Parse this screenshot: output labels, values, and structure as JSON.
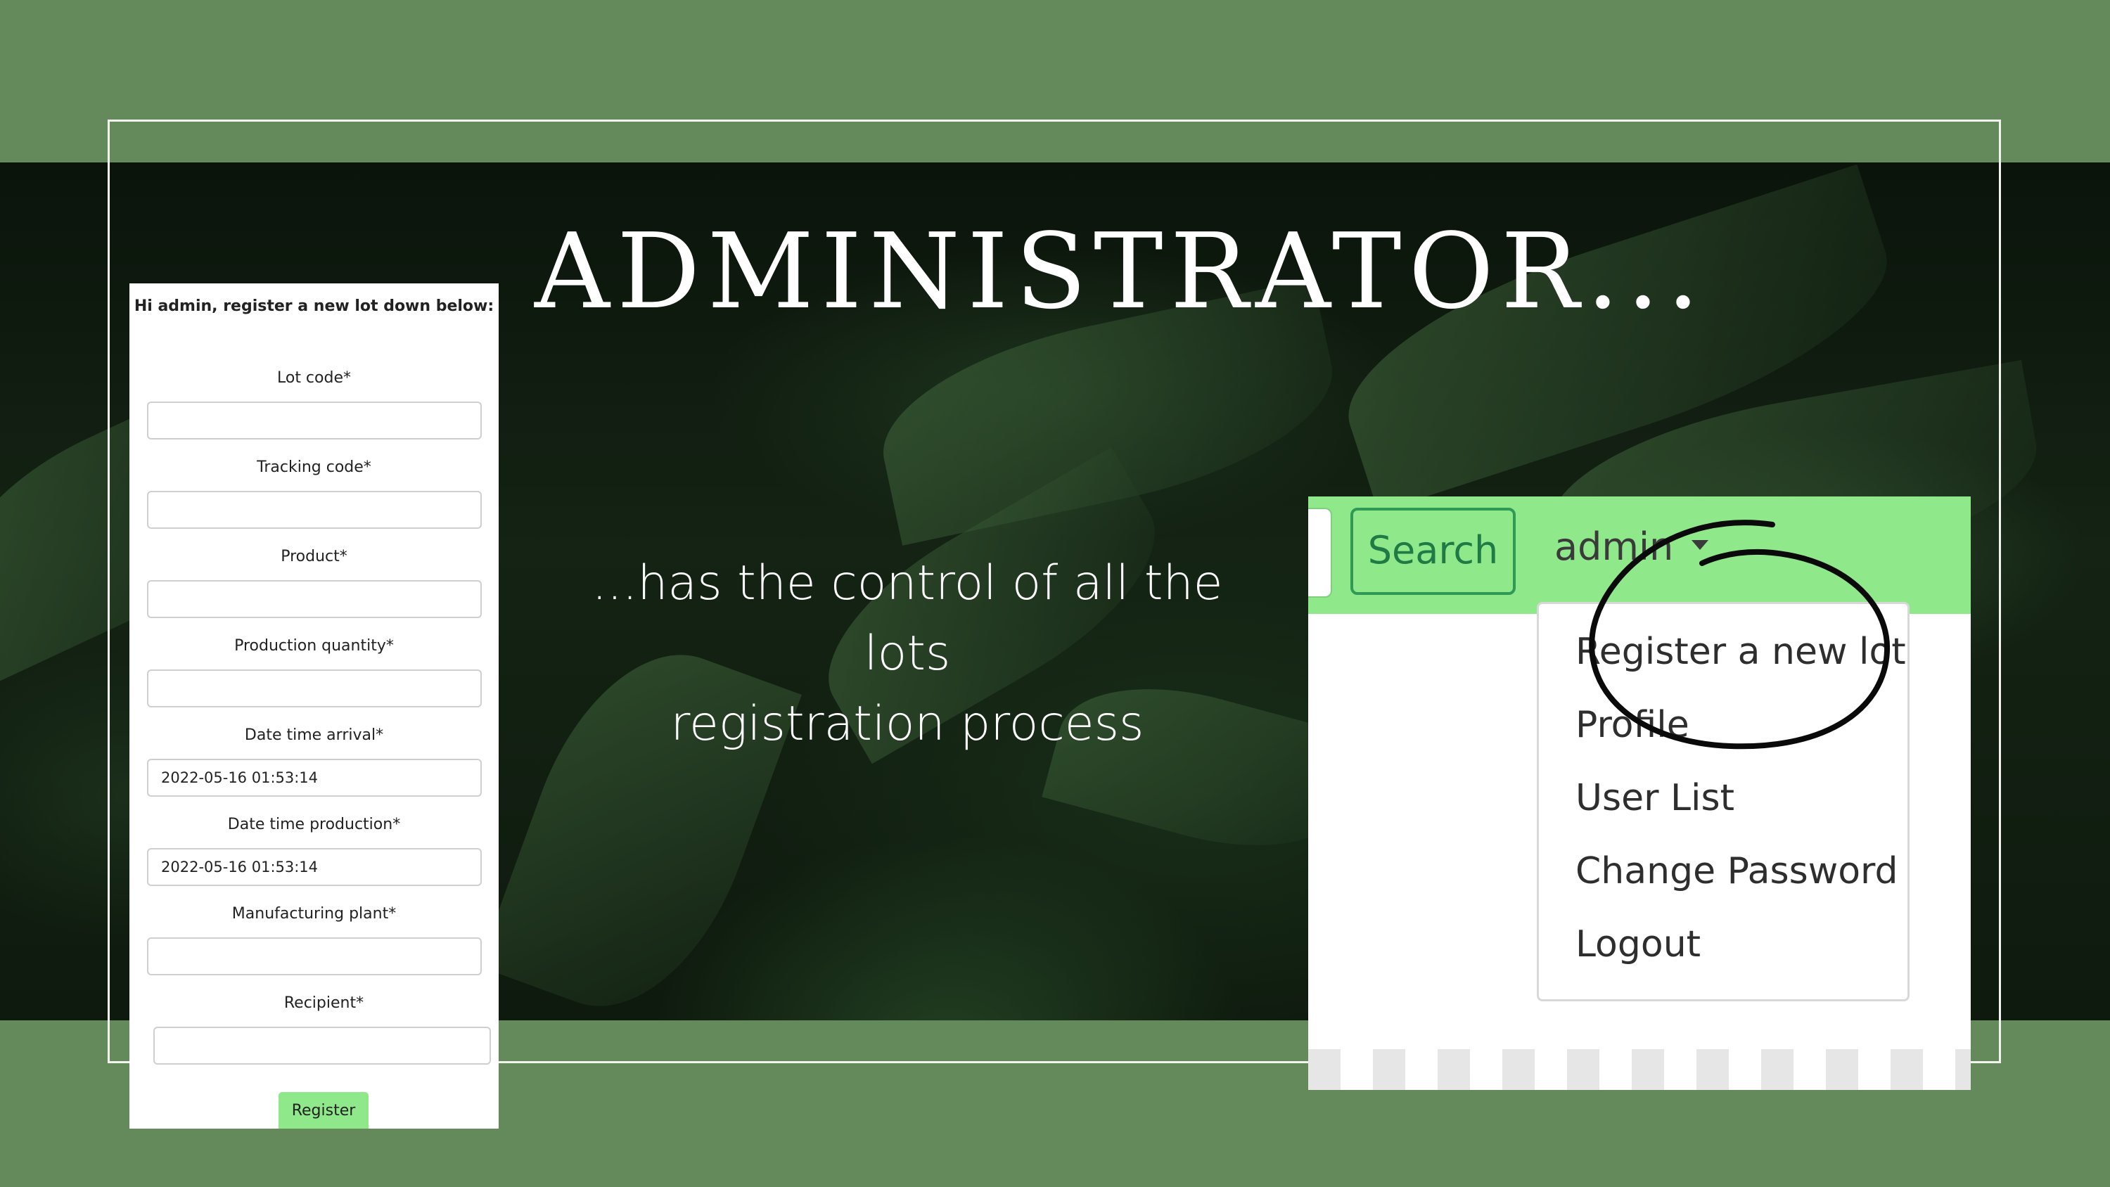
{
  "slide": {
    "title": "ADMINISTRATOR...",
    "subtitle_line1": "...has the control of all the lots",
    "subtitle_line2": "registration process"
  },
  "form": {
    "heading": "Hi admin, register a new lot down below:",
    "fields": [
      {
        "label": "Lot code*",
        "value": ""
      },
      {
        "label": "Tracking code*",
        "value": ""
      },
      {
        "label": "Product*",
        "value": ""
      },
      {
        "label": "Production quantity*",
        "value": ""
      },
      {
        "label": "Date time arrival*",
        "value": "2022-05-16 01:53:14"
      },
      {
        "label": "Date time production*",
        "value": "2022-05-16 01:53:14"
      },
      {
        "label": "Manufacturing plant*",
        "value": ""
      },
      {
        "label": "Recipient*",
        "value": ""
      }
    ],
    "submit_label": "Register"
  },
  "navbar": {
    "search_label": "Search",
    "user_label": "admin",
    "menu_items": [
      {
        "label": "Register a new lot"
      },
      {
        "label": "Profile"
      },
      {
        "label": "User List"
      },
      {
        "label": "Change Password"
      },
      {
        "label": "Logout"
      }
    ],
    "highlighted_item": "Register a new lot"
  },
  "colors": {
    "background": "#64895a",
    "navbar_green": "#8fe88a",
    "search_border": "#2f9a56",
    "frame": "#f3f3ef"
  }
}
